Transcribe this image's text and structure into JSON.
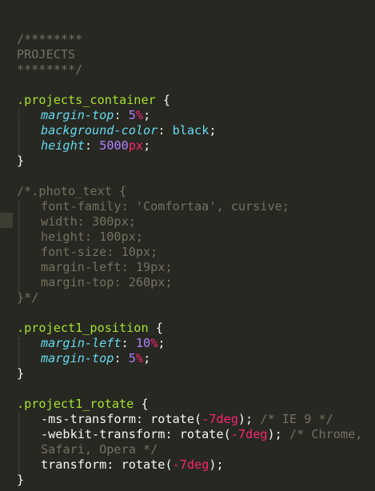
{
  "code": {
    "c1": "/********",
    "c2": "PROJECTS",
    "c3": "********/",
    "sel_container": ".projects_container",
    "brace_open": " {",
    "brace_close": "}",
    "colon": ":",
    "semi": ";",
    "p_margin_top": "margin-top",
    "v_margin_top": "5",
    "u_pct": "%",
    "p_bg": "background-color",
    "v_bg": "black",
    "p_height": "height",
    "v_height": "5000",
    "u_px": "px",
    "cb1": "/*.photo_text {",
    "cb2": "font-family: 'Comfortaa', cursive;",
    "cb3": "width: 300px;",
    "cb4": "height: 100px;",
    "cb5": "font-size: 10px;",
    "cb6": "margin-left: 19px;",
    "cb7": "margin-top: 260px;",
    "cb8": "}*/",
    "sel_pos": ".project1_position",
    "p_margin_left": "margin-left",
    "v_margin_left": "10",
    "v_margin_top2": "5",
    "sel_rot": ".project1_rotate",
    "ms_prop": "-ms-transform: rotate(",
    "neg7": "-7",
    "deg": "deg",
    "close_paren": ");",
    "ms_cm": " /* IE 9 */",
    "wk_prop": "-webkit-transform: rotate(",
    "wk_cm": " /* Chrome,",
    "wk_cm2": "Safari, Opera */",
    "tf_prop": "transform: rotate("
  }
}
